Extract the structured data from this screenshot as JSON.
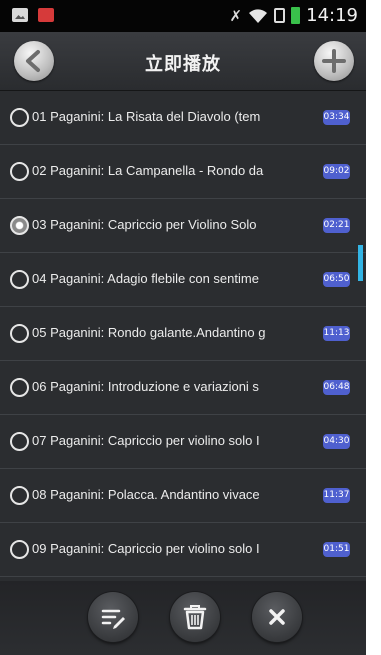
{
  "statusbar": {
    "time": "14:19"
  },
  "header": {
    "title": "立即播放"
  },
  "tracks": [
    {
      "title": "01 Paganini: La Risata del Diavolo (tem",
      "duration": "03:34",
      "selected": false
    },
    {
      "title": "02 Paganini: La Campanella - Rondo da",
      "duration": "09:02",
      "selected": false
    },
    {
      "title": "03 Paganini: Capriccio per Violino Solo",
      "duration": "02:21",
      "selected": true
    },
    {
      "title": "04 Paganini: Adagio flebile con sentime",
      "duration": "06:50",
      "selected": false
    },
    {
      "title": "05 Paganini: Rondo galante.Andantino g",
      "duration": "11:13",
      "selected": false
    },
    {
      "title": "06 Paganini: Introduzione e variazioni s",
      "duration": "06:48",
      "selected": false
    },
    {
      "title": "07 Paganini: Capriccio per violino solo I",
      "duration": "04:30",
      "selected": false
    },
    {
      "title": "08 Paganini: Polacca. Andantino vivace",
      "duration": "11:37",
      "selected": false
    },
    {
      "title": "09 Paganini: Capriccio per violino solo I",
      "duration": "01:51",
      "selected": false
    }
  ],
  "icons": {
    "back": "back-arrow-icon",
    "add": "plus-icon",
    "edit": "edit-list-icon",
    "delete": "trash-icon",
    "close": "close-icon"
  },
  "colors": {
    "accent": "#33b5e5",
    "duration_badge": "#4f60cf",
    "battery": "#39c14b"
  }
}
